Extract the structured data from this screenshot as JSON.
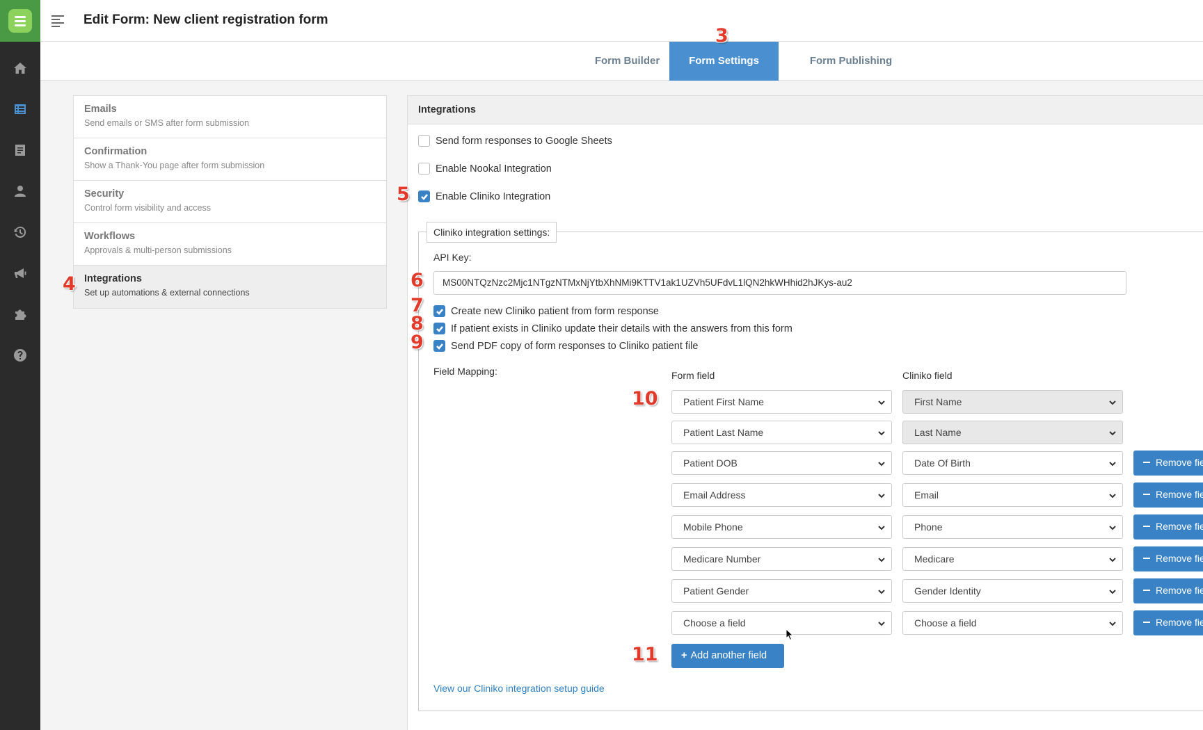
{
  "header": {
    "title": "Edit Form: New client registration form"
  },
  "rail": {
    "icons": [
      "home-icon",
      "forms-icon",
      "document-icon",
      "user-icon",
      "history-icon",
      "megaphone-icon",
      "puzzle-icon",
      "help-icon"
    ],
    "active": "forms-icon"
  },
  "tabs": [
    {
      "label": "Form Builder"
    },
    {
      "label": "Form Settings",
      "active": true
    },
    {
      "label": "Form Publishing"
    }
  ],
  "settings": [
    {
      "title": "Emails",
      "desc": "Send emails or SMS after form submission"
    },
    {
      "title": "Confirmation",
      "desc": "Show a Thank-You page after form submission"
    },
    {
      "title": "Security",
      "desc": "Control form visibility and access"
    },
    {
      "title": "Workflows",
      "desc": "Approvals & multi-person submissions"
    },
    {
      "title": "Integrations",
      "desc": "Set up automations & external connections",
      "active": true
    }
  ],
  "panel": {
    "title": "Integrations",
    "options": [
      {
        "label": "Send form responses to Google Sheets",
        "checked": false
      },
      {
        "label": "Enable Nookal Integration",
        "checked": false
      },
      {
        "label": "Enable Cliniko Integration",
        "checked": true
      }
    ],
    "cliniko": {
      "legend": "Cliniko integration settings:",
      "api_key_label": "API Key:",
      "api_key_value": "MS00NTQzNzc2Mjc1NTgzNTMxNjYtbXhNMi9KTTV1ak1UZVh5UFdvL1lQN2hkWHhid2hJKys-au2",
      "sub_options": [
        {
          "label": "Create new Cliniko patient from form response",
          "checked": true
        },
        {
          "label": "If patient exists in Cliniko update their details with the answers from this form",
          "checked": true
        },
        {
          "label": "Send PDF copy of form responses to Cliniko patient file",
          "checked": true
        }
      ],
      "mapping_label": "Field Mapping:",
      "form_field_head": "Form field",
      "cliniko_field_head": "Cliniko field",
      "rows": [
        {
          "form": "Patient First Name",
          "cliniko": "First Name",
          "locked": true
        },
        {
          "form": "Patient Last Name",
          "cliniko": "Last Name",
          "locked": true
        },
        {
          "form": "Patient DOB",
          "cliniko": "Date Of Birth",
          "locked": false
        },
        {
          "form": "Email Address",
          "cliniko": "Email",
          "locked": false
        },
        {
          "form": "Mobile Phone",
          "cliniko": "Phone",
          "locked": false
        },
        {
          "form": "Medicare Number",
          "cliniko": "Medicare",
          "locked": false
        },
        {
          "form": "Patient Gender",
          "cliniko": "Gender Identity",
          "locked": false
        },
        {
          "form": "Choose a field",
          "cliniko": "Choose a field",
          "locked": false
        }
      ],
      "remove_label": "Remove field",
      "add_label": "Add another field",
      "guide_link": "View our Cliniko integration setup guide"
    }
  },
  "annotations": [
    "3",
    "4",
    "5",
    "6",
    "7",
    "8",
    "9",
    "10",
    "11"
  ],
  "colors": {
    "accent": "#4a90d0",
    "button": "#3a82c6",
    "annotation": "#e23b2b",
    "brand": "#8cd25d"
  }
}
